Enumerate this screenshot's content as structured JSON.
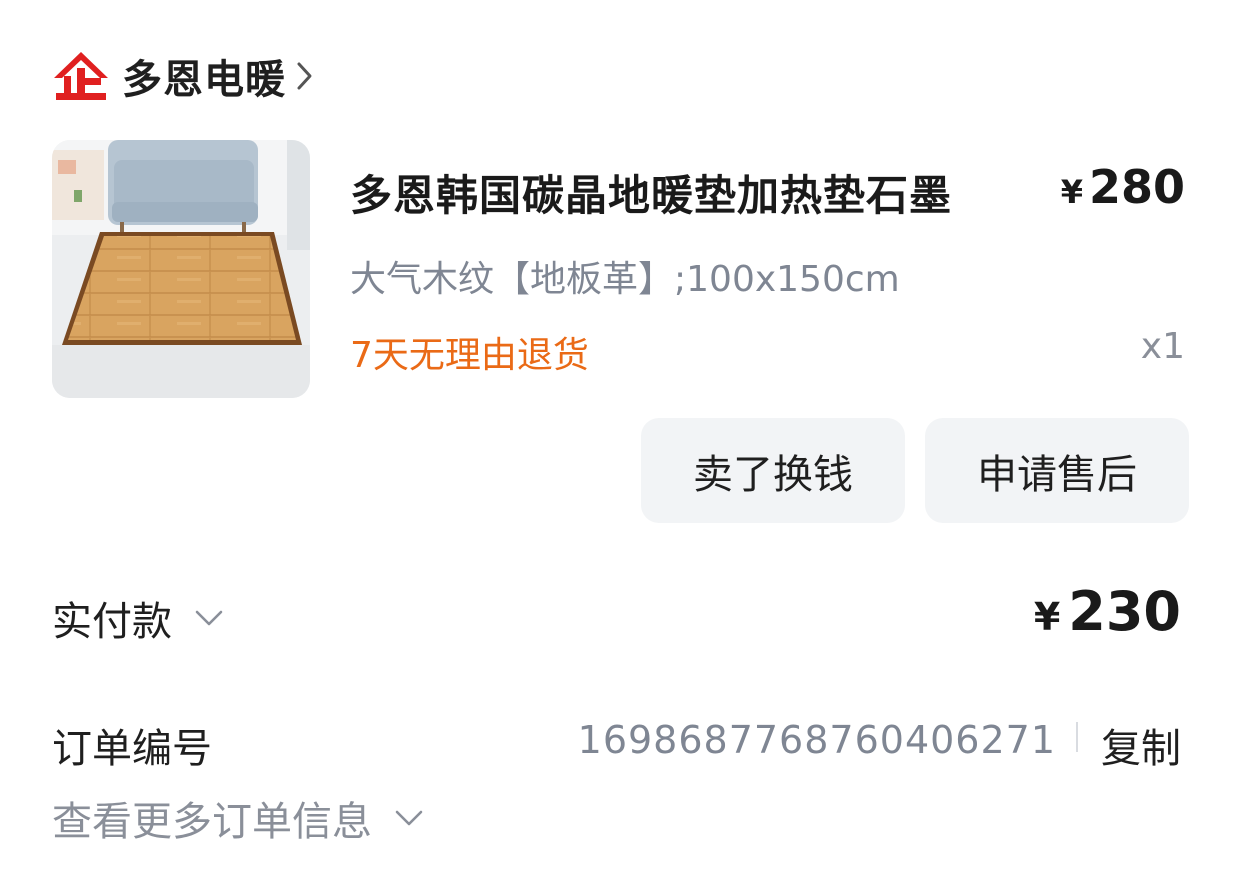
{
  "store": {
    "name": "多恩电暖",
    "logo_icon": "enterprise-logo-icon",
    "logo_color": "#e02020"
  },
  "product": {
    "title": "多恩韩国碳晶地暖垫加热垫石墨",
    "price_symbol": "¥",
    "price": "280",
    "spec": "大气木纹【地板革】;100x150cm",
    "policy": "7天无理由退货",
    "policy_color": "#ea6a16",
    "quantity": "x1"
  },
  "actions": {
    "sell_label": "卖了换钱",
    "aftersale_label": "申请售后"
  },
  "payment": {
    "label": "实付款",
    "symbol": "¥",
    "amount": "230"
  },
  "order": {
    "label": "订单编号",
    "number": "1698687768760406271",
    "copy_label": "复制",
    "more_label": "查看更多订单信息"
  }
}
